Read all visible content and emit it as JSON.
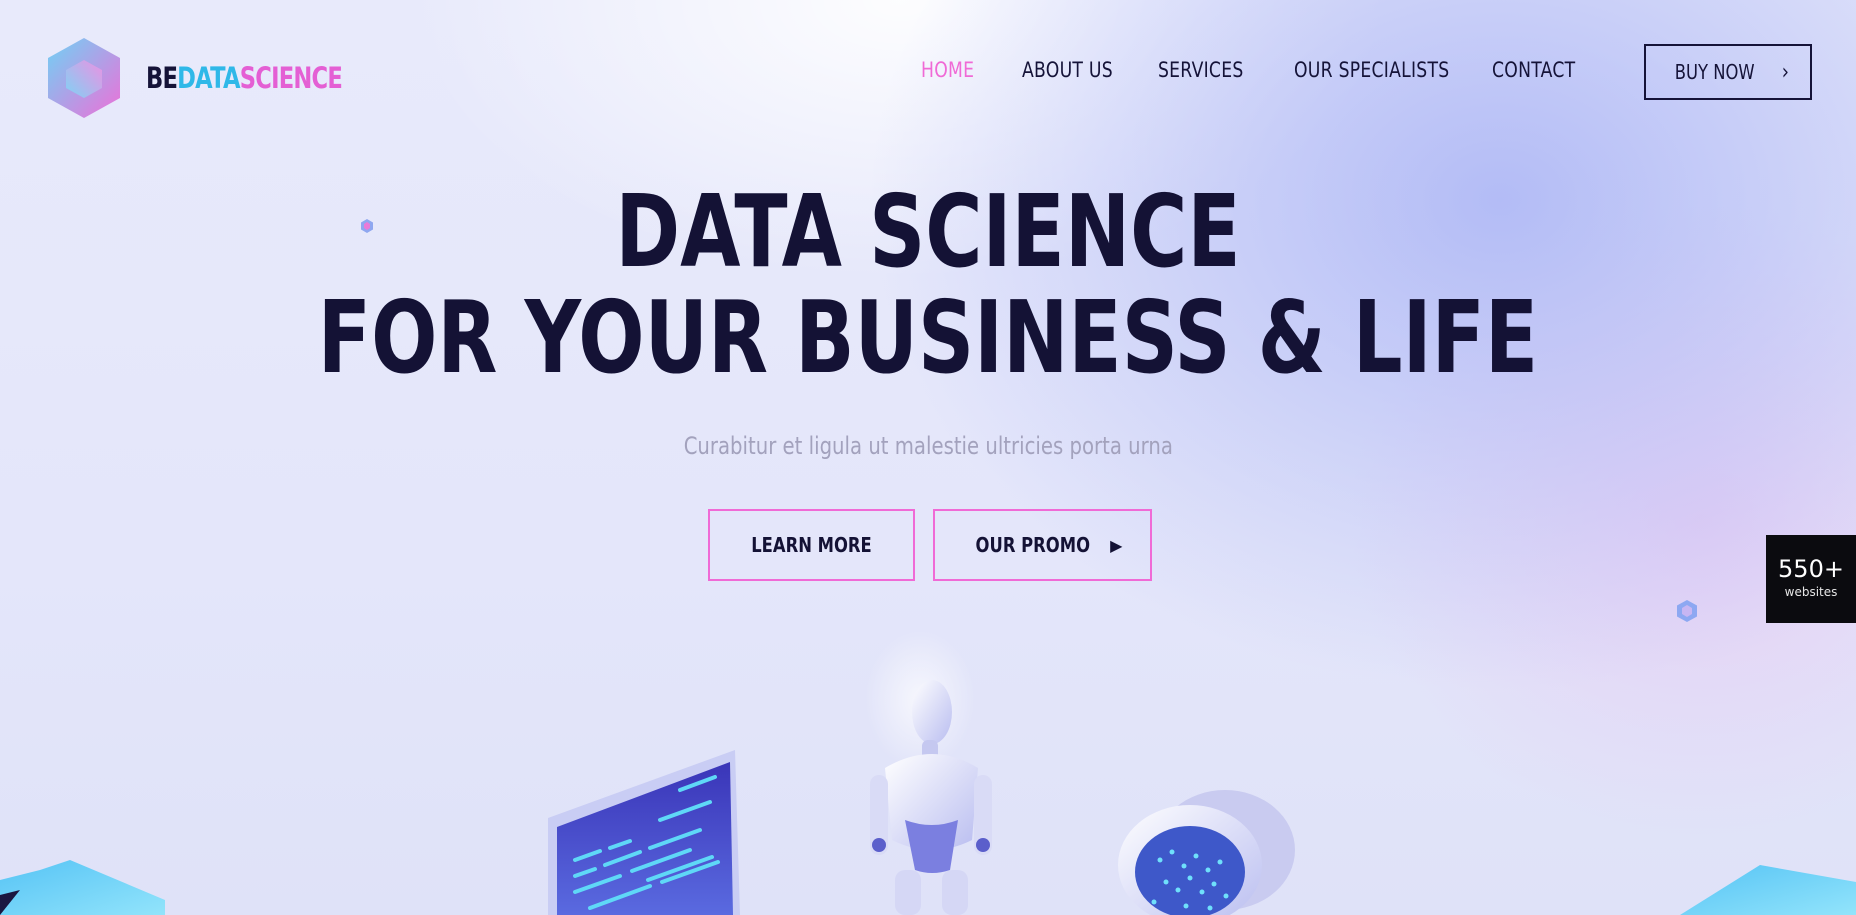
{
  "brand": {
    "part1": "BE",
    "part2": "DATA",
    "part3": "SCIENCE"
  },
  "nav": [
    {
      "label": "HOME",
      "active": true
    },
    {
      "label": "ABOUT US",
      "active": false
    },
    {
      "label": "SERVICES",
      "active": false
    },
    {
      "label": "OUR SPECIALISTS",
      "active": false
    },
    {
      "label": "CONTACT",
      "active": false
    }
  ],
  "cta": {
    "buy_label": "BUY NOW"
  },
  "hero": {
    "title_line1": "DATA SCIENCE",
    "title_line2": "FOR YOUR BUSINESS & LIFE",
    "subtitle": "Curabitur et ligula ut malestie ultricies porta urna",
    "learn_label": "LEARN MORE",
    "promo_label": "OUR PROMO"
  },
  "badge": {
    "count": "550+",
    "label": "websites"
  },
  "colors": {
    "accent_pink": "#f06ad6",
    "accent_cyan": "#2fb8e8",
    "dark": "#141235",
    "muted": "#a3a2bd"
  },
  "icons": [
    "hexagon-logo-icon",
    "chevron-right-icon",
    "play-triangle-icon",
    "robot-illustration",
    "monitor-illustration",
    "data-ring-illustration"
  ]
}
